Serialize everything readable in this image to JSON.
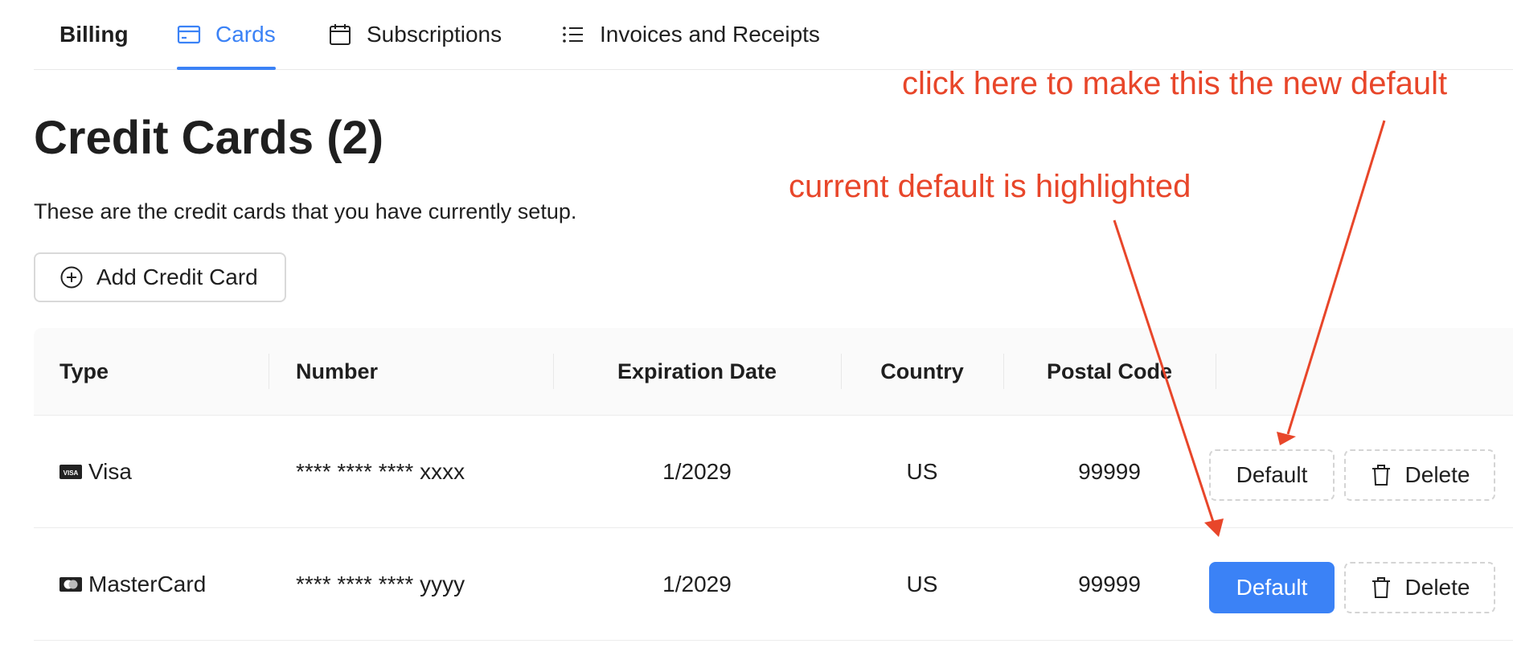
{
  "tabs": [
    {
      "label": "Billing",
      "icon": ""
    },
    {
      "label": "Cards",
      "icon": "credit-card-icon",
      "active": true
    },
    {
      "label": "Subscriptions",
      "icon": "calendar-icon"
    },
    {
      "label": "Invoices and Receipts",
      "icon": "list-icon"
    }
  ],
  "page": {
    "title": "Credit Cards (2)",
    "description": "These are the credit cards that you have currently setup.",
    "add_button": "Add Credit Card"
  },
  "table": {
    "columns": [
      "Type",
      "Number",
      "Expiration Date",
      "Country",
      "Postal Code"
    ],
    "rows": [
      {
        "type": "Visa",
        "type_icon": "visa-icon",
        "number": "**** **** **** xxxx",
        "expiration": "1/2029",
        "country": "US",
        "postal": "99999",
        "default_label": "Default",
        "delete_label": "Delete",
        "is_default": false
      },
      {
        "type": "MasterCard",
        "type_icon": "mastercard-icon",
        "number": "**** **** **** yyyy",
        "expiration": "1/2029",
        "country": "US",
        "postal": "99999",
        "default_label": "Default",
        "delete_label": "Delete",
        "is_default": true
      }
    ]
  },
  "annotations": {
    "make_default": "click here to make this the new default",
    "current_default": "current default is highlighted",
    "color": "#e8462a"
  },
  "colors": {
    "accent": "#3b82f6"
  }
}
